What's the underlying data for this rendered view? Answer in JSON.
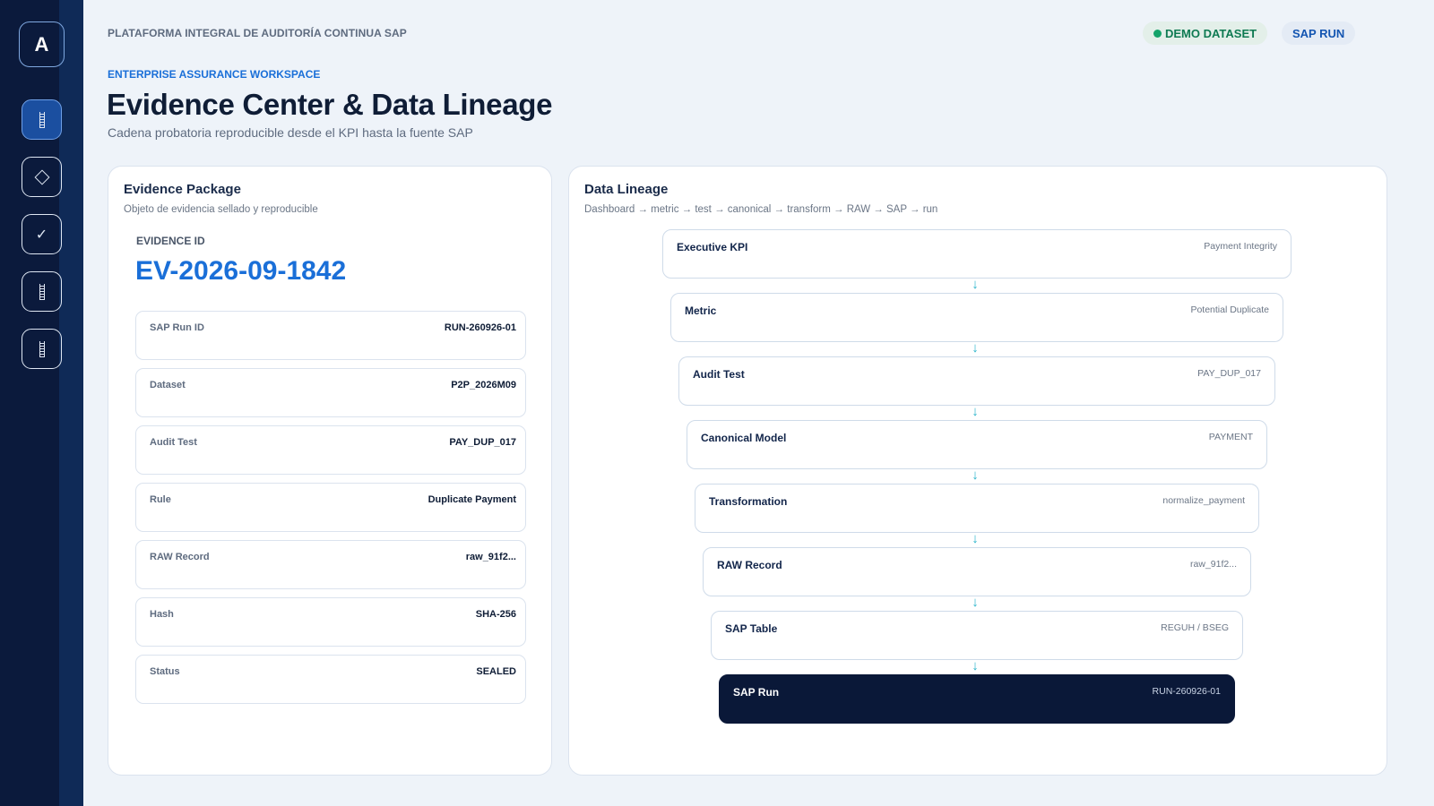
{
  "sidebar": {
    "logo": "A",
    "items": [
      {
        "icon": "bars-icon",
        "active": true
      },
      {
        "icon": "diamond-icon",
        "active": false
      },
      {
        "icon": "check-icon",
        "glyph": "✓",
        "active": false
      },
      {
        "icon": "bars-icon",
        "active": false
      },
      {
        "icon": "bars-icon",
        "active": false
      }
    ]
  },
  "header": {
    "platform": "PLATAFORMA INTEGRAL DE AUDITORÍA CONTINUA SAP",
    "demo_badge": "DEMO DATASET",
    "sap_badge": "SAP RUN",
    "workspace": "ENTERPRISE ASSURANCE WORKSPACE",
    "title": "Evidence Center & Data Lineage",
    "subtitle": "Cadena probatoria reproducible desde el KPI hasta la fuente SAP"
  },
  "evidence": {
    "title": "Evidence Package",
    "subtitle": "Objeto de evidencia sellado y reproducible",
    "id_label": "EVIDENCE ID",
    "id_value": "EV-2026-09-1842",
    "fields": [
      {
        "label": "SAP Run ID",
        "value": "RUN-260926-01"
      },
      {
        "label": "Dataset",
        "value": "P2P_2026M09"
      },
      {
        "label": "Audit Test",
        "value": "PAY_DUP_017"
      },
      {
        "label": "Rule",
        "value": "Duplicate Payment"
      },
      {
        "label": "RAW Record",
        "value": "raw_91f2..."
      },
      {
        "label": "Hash",
        "value": "SHA-256"
      },
      {
        "label": "Status",
        "value": "SEALED"
      }
    ]
  },
  "lineage": {
    "title": "Data Lineage",
    "subtitle": "Dashboard → metric → test → canonical → transform → RAW → SAP → run",
    "arrow_glyph": "↓",
    "nodes": [
      {
        "label": "Executive KPI",
        "value": "Payment Integrity"
      },
      {
        "label": "Metric",
        "value": "Potential Duplicate"
      },
      {
        "label": "Audit Test",
        "value": "PAY_DUP_017"
      },
      {
        "label": "Canonical Model",
        "value": "PAYMENT"
      },
      {
        "label": "Transformation",
        "value": "normalize_payment"
      },
      {
        "label": "RAW Record",
        "value": "raw_91f2..."
      },
      {
        "label": "SAP Table",
        "value": "REGUH / BSEG"
      },
      {
        "label": "SAP Run",
        "value": "RUN-260926-01"
      }
    ]
  },
  "colors": {
    "accent": "#1a6fd8",
    "sidebar": "#0b1a3c",
    "status_green": "#14a36a",
    "arrow": "#28b3c9",
    "dark_node": "#0a1838"
  }
}
